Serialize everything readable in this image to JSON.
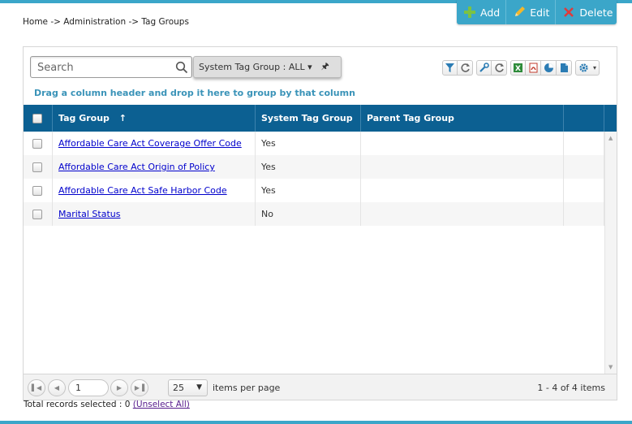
{
  "breadcrumb": "Home -> Administration -> Tag Groups",
  "actions": {
    "add_label": "Add",
    "edit_label": "Edit",
    "delete_label": "Delete"
  },
  "search": {
    "placeholder": "Search",
    "value": ""
  },
  "filter": {
    "label": "System Tag Group : ALL ▾",
    "pin_icon": "pin-icon"
  },
  "toolbar_icons": [
    "filter-icon",
    "refresh-icon",
    "wrench-icon",
    "refresh-icon",
    "excel-icon",
    "pdf-icon",
    "chart-icon",
    "document-icon",
    "gear-icon"
  ],
  "group_hint": "Drag a column header and drop it here to group by that column",
  "columns": {
    "tag_group": "Tag Group",
    "sort_indicator": "↑",
    "system_tag_group": "System Tag Group",
    "parent_tag_group": "Parent Tag Group"
  },
  "rows": [
    {
      "tag_group": "Affordable Care Act Coverage Offer Code",
      "system": "Yes",
      "parent": ""
    },
    {
      "tag_group": "Affordable Care Act Origin of Policy",
      "system": "Yes",
      "parent": ""
    },
    {
      "tag_group": "Affordable Care Act Safe Harbor Code",
      "system": "Yes",
      "parent": ""
    },
    {
      "tag_group": "Marital Status",
      "system": "No",
      "parent": ""
    }
  ],
  "pager": {
    "page": "1",
    "page_size": "25",
    "items_per_page_label": "items per page",
    "info": "1 - 4 of 4 items"
  },
  "footer": {
    "records_label": "Total records selected : 0",
    "unselect_label": "(Unselect All)"
  },
  "colors": {
    "accent": "#3ba6c9",
    "header": "#0c6092",
    "link": "#0000cc"
  }
}
